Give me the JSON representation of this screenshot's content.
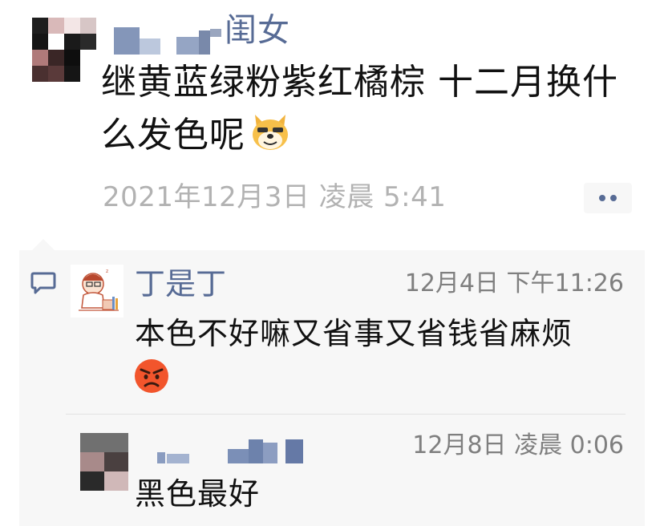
{
  "post": {
    "author_name_visible": "闺女",
    "text": "继黄蓝绿粉紫红橘棕 十二月换什么发色呢",
    "timestamp": "2021年12月3日 凌晨 5:41",
    "emoji": "doge-icon"
  },
  "comments": [
    {
      "author": "丁是丁",
      "time": "12月4日 下午11:26",
      "text": "本色不好嘛又省事又省钱省麻烦",
      "emoji": "angry-face-icon"
    },
    {
      "author": "",
      "time": "12月8日 凌晨 0:06",
      "text": "黑色最好"
    }
  ],
  "colors": {
    "link_blue": "#576b95",
    "meta_gray": "#b2b2b2",
    "comment_bg": "#f7f7f7",
    "text": "#111111"
  }
}
